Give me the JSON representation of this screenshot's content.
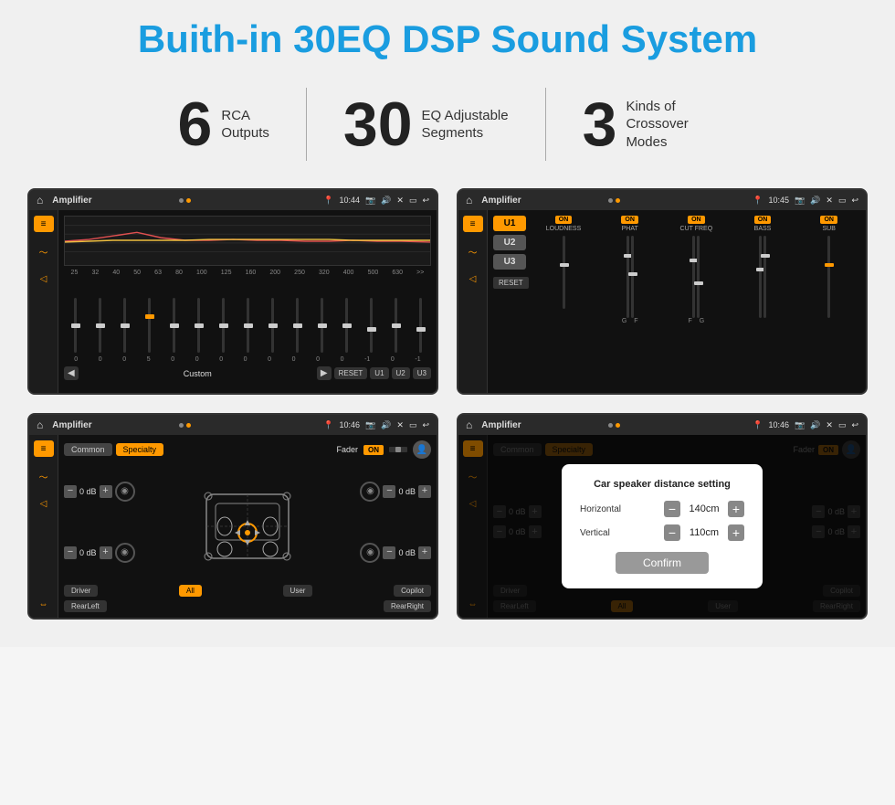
{
  "title": "Buith-in 30EQ DSP Sound System",
  "stats": [
    {
      "number": "6",
      "text_line1": "RCA",
      "text_line2": "Outputs"
    },
    {
      "number": "30",
      "text_line1": "EQ Adjustable",
      "text_line2": "Segments"
    },
    {
      "number": "3",
      "text_line1": "Kinds of",
      "text_line2": "Crossover Modes"
    }
  ],
  "screens": [
    {
      "id": "screen1",
      "statusbar": {
        "title": "Amplifier",
        "time": "10:44"
      },
      "type": "eq"
    },
    {
      "id": "screen2",
      "statusbar": {
        "title": "Amplifier",
        "time": "10:45"
      },
      "type": "amplifier"
    },
    {
      "id": "screen3",
      "statusbar": {
        "title": "Amplifier",
        "time": "10:46"
      },
      "type": "fader"
    },
    {
      "id": "screen4",
      "statusbar": {
        "title": "Amplifier",
        "time": "10:46"
      },
      "type": "fader-dialog"
    }
  ],
  "eq": {
    "frequencies": [
      "25",
      "32",
      "40",
      "50",
      "63",
      "80",
      "100",
      "125",
      "160",
      "200",
      "250",
      "320",
      "400",
      "500",
      "630"
    ],
    "values": [
      "0",
      "0",
      "0",
      "5",
      "0",
      "0",
      "0",
      "0",
      "0",
      "0",
      "0",
      "0",
      "-1",
      "0",
      "-1"
    ],
    "preset": "Custom",
    "buttons": [
      "RESET",
      "U1",
      "U2",
      "U3"
    ]
  },
  "amplifier": {
    "channels": [
      "LOUDNESS",
      "PHAT",
      "CUT FREQ",
      "BASS",
      "SUB"
    ],
    "u_labels": [
      "U1",
      "U2",
      "U3"
    ],
    "reset_label": "RESET"
  },
  "fader": {
    "tabs": [
      "Common",
      "Specialty"
    ],
    "fader_label": "Fader",
    "on_label": "ON",
    "controls": {
      "left_top": "0 dB",
      "left_bottom": "0 dB",
      "right_top": "0 dB",
      "right_bottom": "0 dB"
    },
    "buttons": [
      "Driver",
      "All",
      "User",
      "Copilot",
      "RearLeft",
      "RearRight"
    ]
  },
  "dialog": {
    "title": "Car speaker distance setting",
    "horizontal_label": "Horizontal",
    "horizontal_value": "140cm",
    "vertical_label": "Vertical",
    "vertical_value": "110cm",
    "confirm_label": "Confirm"
  }
}
